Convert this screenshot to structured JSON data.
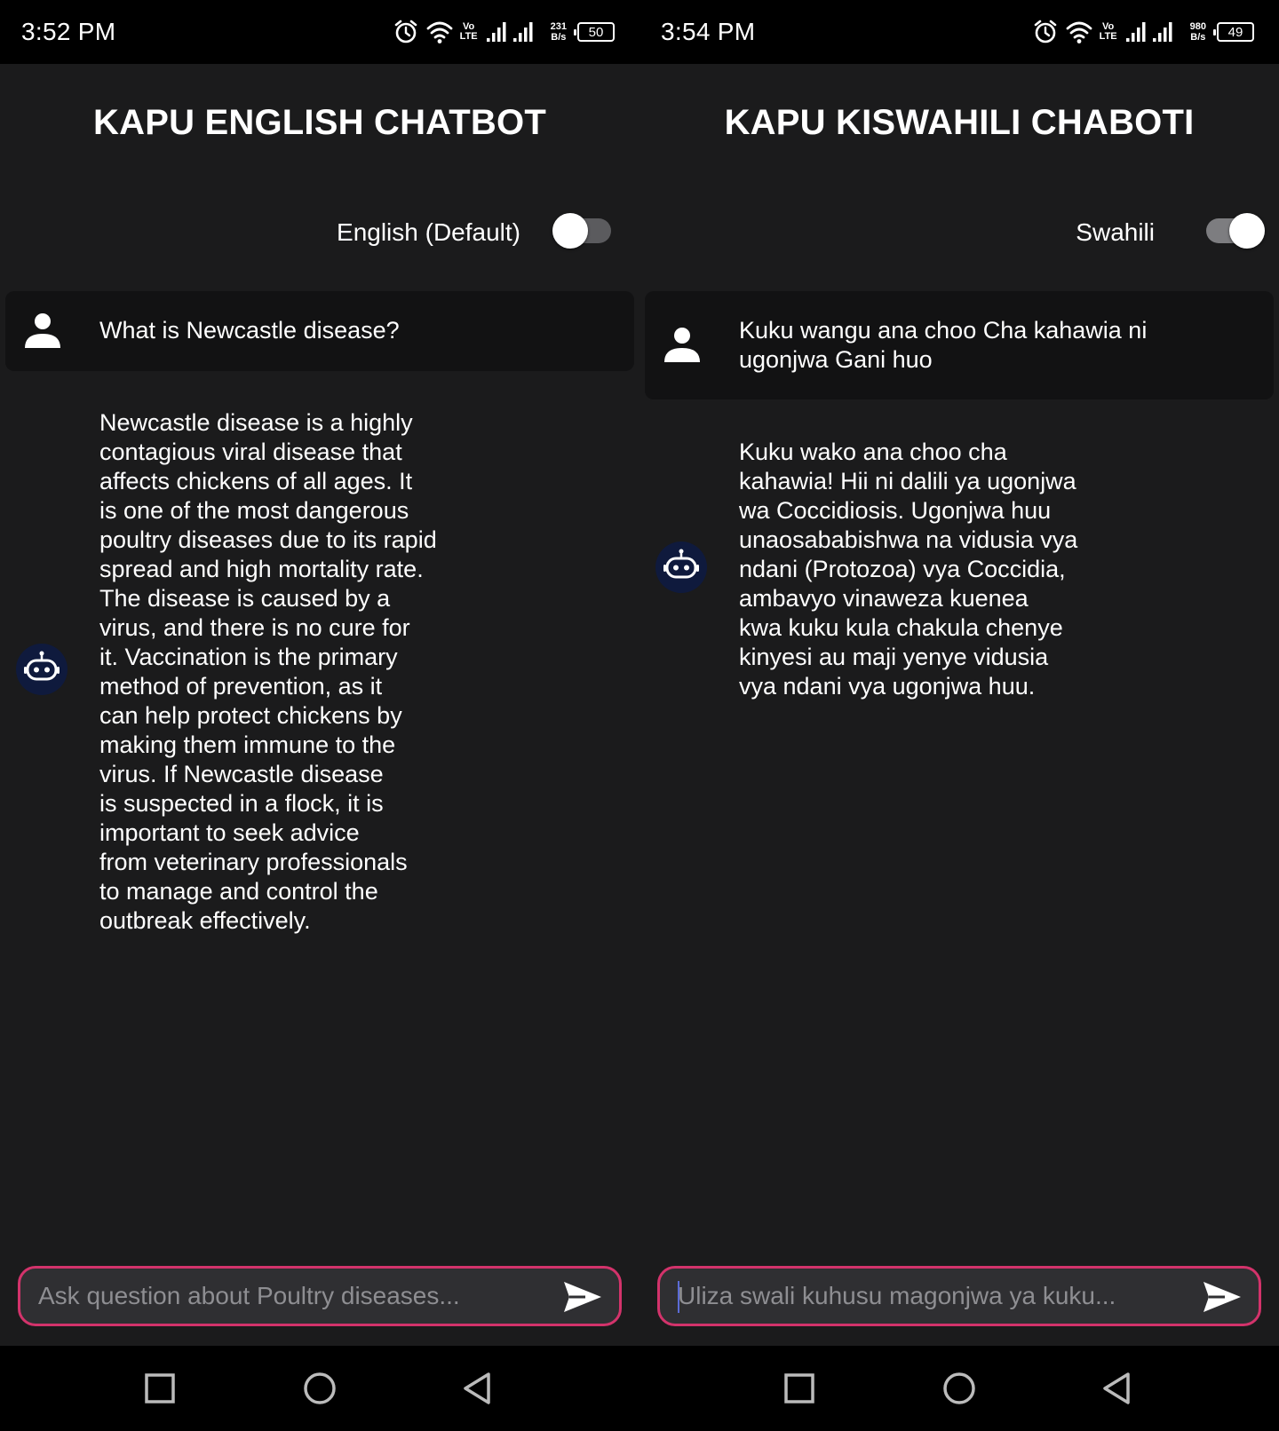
{
  "left": {
    "status": {
      "time": "3:52 PM",
      "volte_top": "Vo",
      "volte_bottom": "LTE",
      "speed_value": "231",
      "speed_unit": "B/s",
      "battery": "50"
    },
    "title": "KAPU ENGLISH CHATBOT",
    "language_label": "English (Default)",
    "toggle_on": false,
    "user_message": "What is Newcastle disease?",
    "bot_message": "Newcastle disease is a highly\ncontagious viral disease that\naffects chickens of all ages. It\nis one of the most dangerous\npoultry diseases due to its rapid\nspread and high mortality rate.\nThe disease is caused by a\nvirus, and there is no cure for\nit. Vaccination is the primary\nmethod of prevention, as it\ncan help protect chickens by\nmaking them immune to the\nvirus. If Newcastle disease\nis suspected in a flock, it is\nimportant to seek advice\nfrom veterinary professionals\nto manage and control the\noutbreak effectively.",
    "input_placeholder": "Ask question about Poultry diseases...",
    "input_value": ""
  },
  "right": {
    "status": {
      "time": "3:54 PM",
      "volte_top": "Vo",
      "volte_bottom": "LTE",
      "speed_value": "980",
      "speed_unit": "B/s",
      "battery": "49"
    },
    "title": "KAPU KISWAHILI CHABOTI",
    "language_label": "Swahili",
    "toggle_on": true,
    "user_message": "Kuku wangu ana choo Cha kahawia ni ugonjwa Gani huo",
    "bot_message": "Kuku wako ana choo cha\nkahawia! Hii ni dalili ya ugonjwa\nwa Coccidiosis. Ugonjwa huu\nunaosababishwa na vidusia vya\nndani (Protozoa) vya Coccidia,\nambavyo vinaweza kuenea\nkwa kuku kula chakula chenye\nkinyesi au maji yenye vidusia\nvya ndani vya ugonjwa huu.",
    "input_placeholder": "Uliza swali kuhusu magonjwa ya kuku...",
    "input_value": ""
  },
  "colors": {
    "background": "#1b1b1c",
    "user_bubble": "#121213",
    "input_border": "#d3336b",
    "input_fill": "#2f2f32",
    "bot_avatar": "#0f1a3d"
  },
  "icons": {
    "user": "person-icon",
    "bot": "robot-icon",
    "send": "send-icon",
    "nav": [
      "recent-apps-icon",
      "home-icon",
      "back-icon"
    ],
    "status": [
      "alarm-icon",
      "wifi-icon",
      "signal-icon",
      "battery-icon"
    ]
  }
}
